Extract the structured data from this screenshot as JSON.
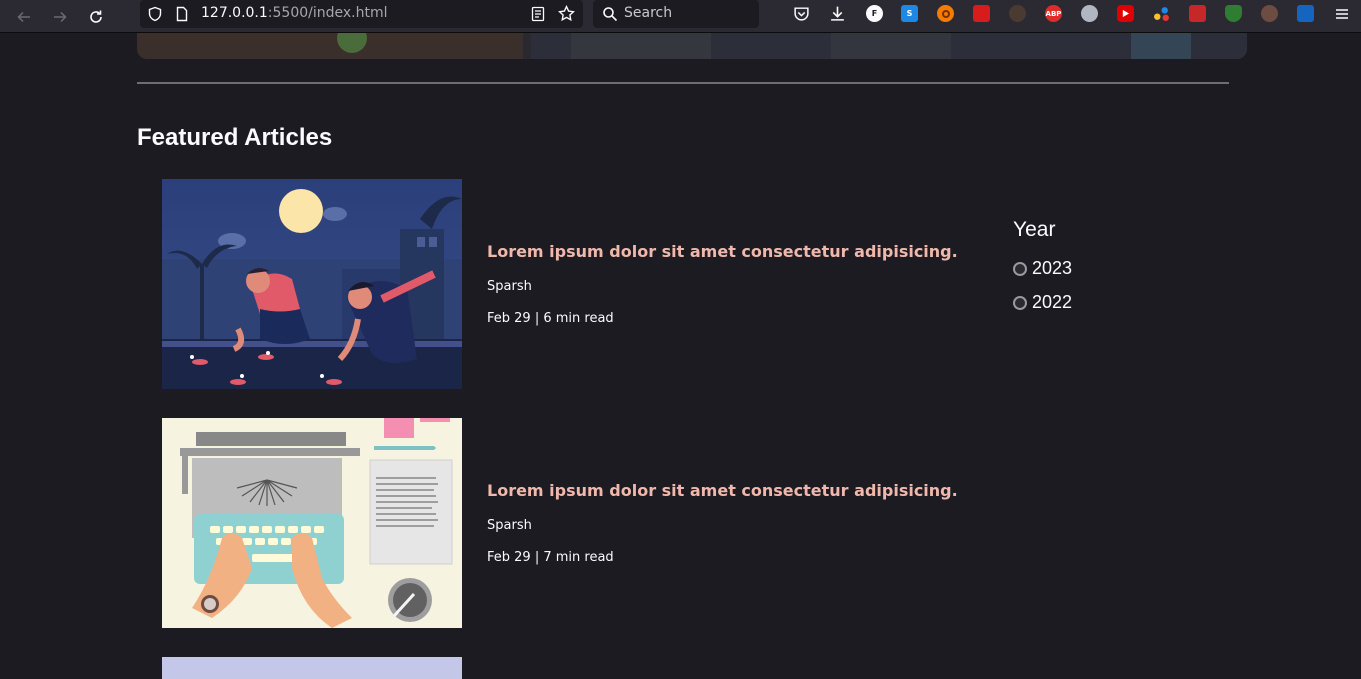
{
  "browser": {
    "url_host": "127.0.0.1",
    "url_rest": ":5500/index.html",
    "search_placeholder": "Search",
    "extensions": [
      "pocket-icon",
      "download-icon",
      "extension-f-icon",
      "extension-s-icon",
      "extension-orange-icon",
      "extension-red-icon",
      "extension-gear-icon",
      "adblock-plus-icon",
      "privacy-badger-icon",
      "youtube-icon",
      "extension-dots-icon",
      "extension-wand-icon",
      "extension-shield-icon",
      "extension-cookie-icon",
      "extension-translate-icon",
      "menu-icon"
    ],
    "extension_labels": {
      "f": "F",
      "s": "S",
      "abp": "ABP"
    }
  },
  "page": {
    "section_title": "Featured Articles",
    "articles": [
      {
        "title": "Lorem ipsum dolor sit amet consectetur adipisicing.",
        "author": "Sparsh",
        "meta": "Feb 29 | 6 min read",
        "image": "diwali-illustration"
      },
      {
        "title": "Lorem ipsum dolor sit amet consectetur adipisicing.",
        "author": "Sparsh",
        "meta": "Feb 29 | 7 min read",
        "image": "typewriter-illustration"
      },
      {
        "image": "lavender-illustration"
      }
    ],
    "filter": {
      "heading": "Year",
      "options": [
        "2023",
        "2022"
      ],
      "selected": null
    }
  },
  "colors": {
    "background": "#1c1b22",
    "title_accent": "#f0b8ac",
    "text": "#fbfbfe"
  }
}
